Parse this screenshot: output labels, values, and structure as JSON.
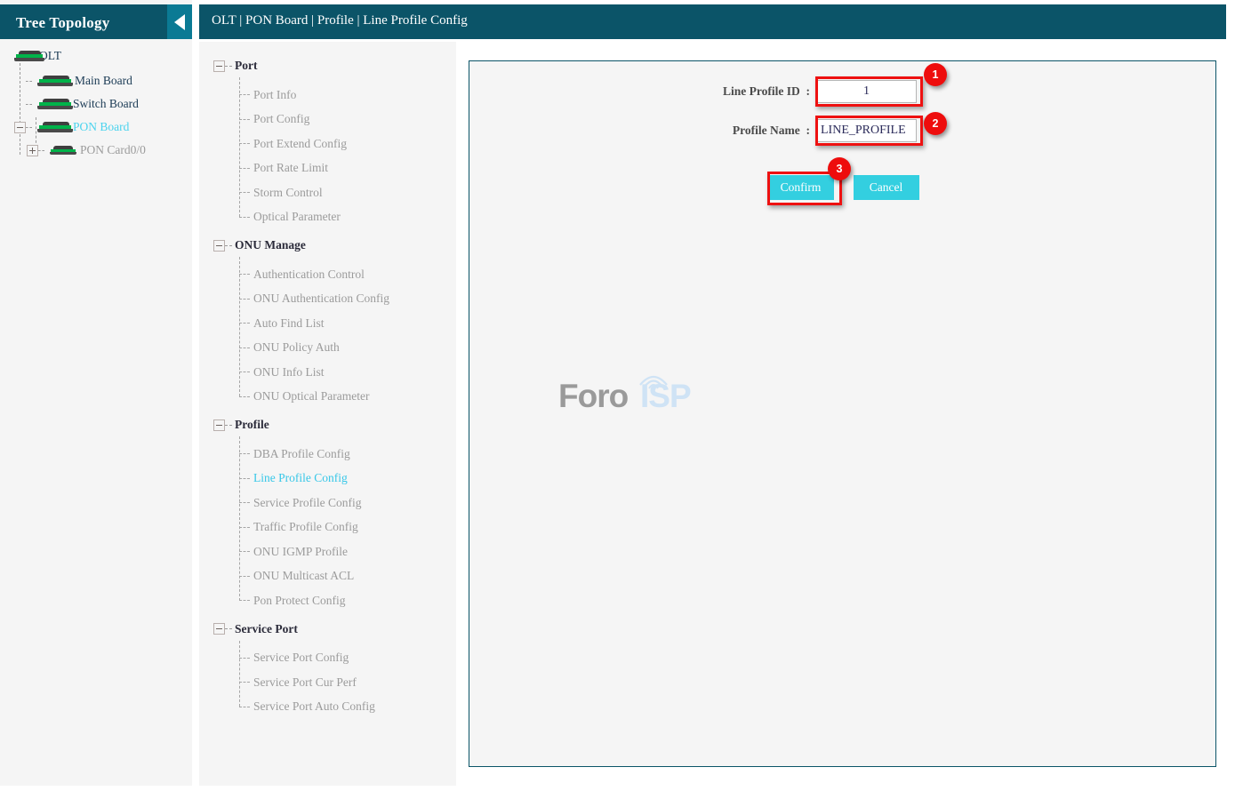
{
  "window": {
    "breadcrumb": "OLT | PON Board | Profile | Line Profile Config"
  },
  "tree_panel": {
    "title": "Tree Topology",
    "collapse_icon": "chevron-left-icon",
    "nodes": [
      {
        "label": "OLT",
        "state": "root",
        "icon": "device-board-icon",
        "expander": "none"
      },
      {
        "label": "Main Board",
        "state": "normal",
        "icon": "device-board-icon",
        "expander": "none"
      },
      {
        "label": "Switch Board",
        "state": "normal",
        "icon": "device-board-icon",
        "expander": "none"
      },
      {
        "label": "PON Board",
        "state": "selected",
        "icon": "device-board-icon",
        "expander": "minus"
      },
      {
        "label": "PON Card0/0",
        "state": "muted",
        "icon": "device-board-icon",
        "expander": "plus"
      }
    ]
  },
  "nav_menu": {
    "groups": [
      {
        "title": "Port",
        "expander": "minus",
        "items": [
          {
            "label": "Port Info",
            "active": false
          },
          {
            "label": "Port Config",
            "active": false
          },
          {
            "label": "Port Extend Config",
            "active": false
          },
          {
            "label": "Port Rate Limit",
            "active": false
          },
          {
            "label": "Storm Control",
            "active": false
          },
          {
            "label": "Optical Parameter",
            "active": false
          }
        ]
      },
      {
        "title": "ONU Manage",
        "expander": "minus",
        "items": [
          {
            "label": "Authentication Control",
            "active": false
          },
          {
            "label": "ONU Authentication Config",
            "active": false
          },
          {
            "label": "Auto Find List",
            "active": false
          },
          {
            "label": "ONU Policy Auth",
            "active": false
          },
          {
            "label": "ONU Info List",
            "active": false
          },
          {
            "label": "ONU Optical Parameter",
            "active": false
          }
        ]
      },
      {
        "title": "Profile",
        "expander": "minus",
        "items": [
          {
            "label": "DBA Profile Config",
            "active": false
          },
          {
            "label": "Line Profile Config",
            "active": true
          },
          {
            "label": "Service Profile Config",
            "active": false
          },
          {
            "label": "Traffic Profile Config",
            "active": false
          },
          {
            "label": "ONU IGMP Profile",
            "active": false
          },
          {
            "label": "ONU Multicast ACL",
            "active": false
          },
          {
            "label": "Pon Protect Config",
            "active": false
          }
        ]
      },
      {
        "title": "Service Port",
        "expander": "minus",
        "items": [
          {
            "label": "Service Port Config",
            "active": false
          },
          {
            "label": "Service Port Cur Perf",
            "active": false
          },
          {
            "label": "Service Port Auto Config",
            "active": false
          }
        ]
      }
    ]
  },
  "form": {
    "fields": [
      {
        "label": "Line Profile ID :",
        "value": "1"
      },
      {
        "label": "Profile Name :",
        "value": "LINE_PROFILE"
      }
    ],
    "confirm_label": "Confirm",
    "cancel_label": "Cancel"
  },
  "annotations": {
    "badge1": "1",
    "badge2": "2",
    "badge3": "3"
  },
  "watermark": {
    "part1": "Foro",
    "part2": "ISP"
  },
  "colors": {
    "header_teal": "#0b5468",
    "collapse_teal": "#0b7a94",
    "accent_cyan": "#33cfe0",
    "active_link": "#37c7e8",
    "annotation_red": "#ee0d0d",
    "panel_bg": "#f5f5f5",
    "led_green": "#00b34a"
  }
}
